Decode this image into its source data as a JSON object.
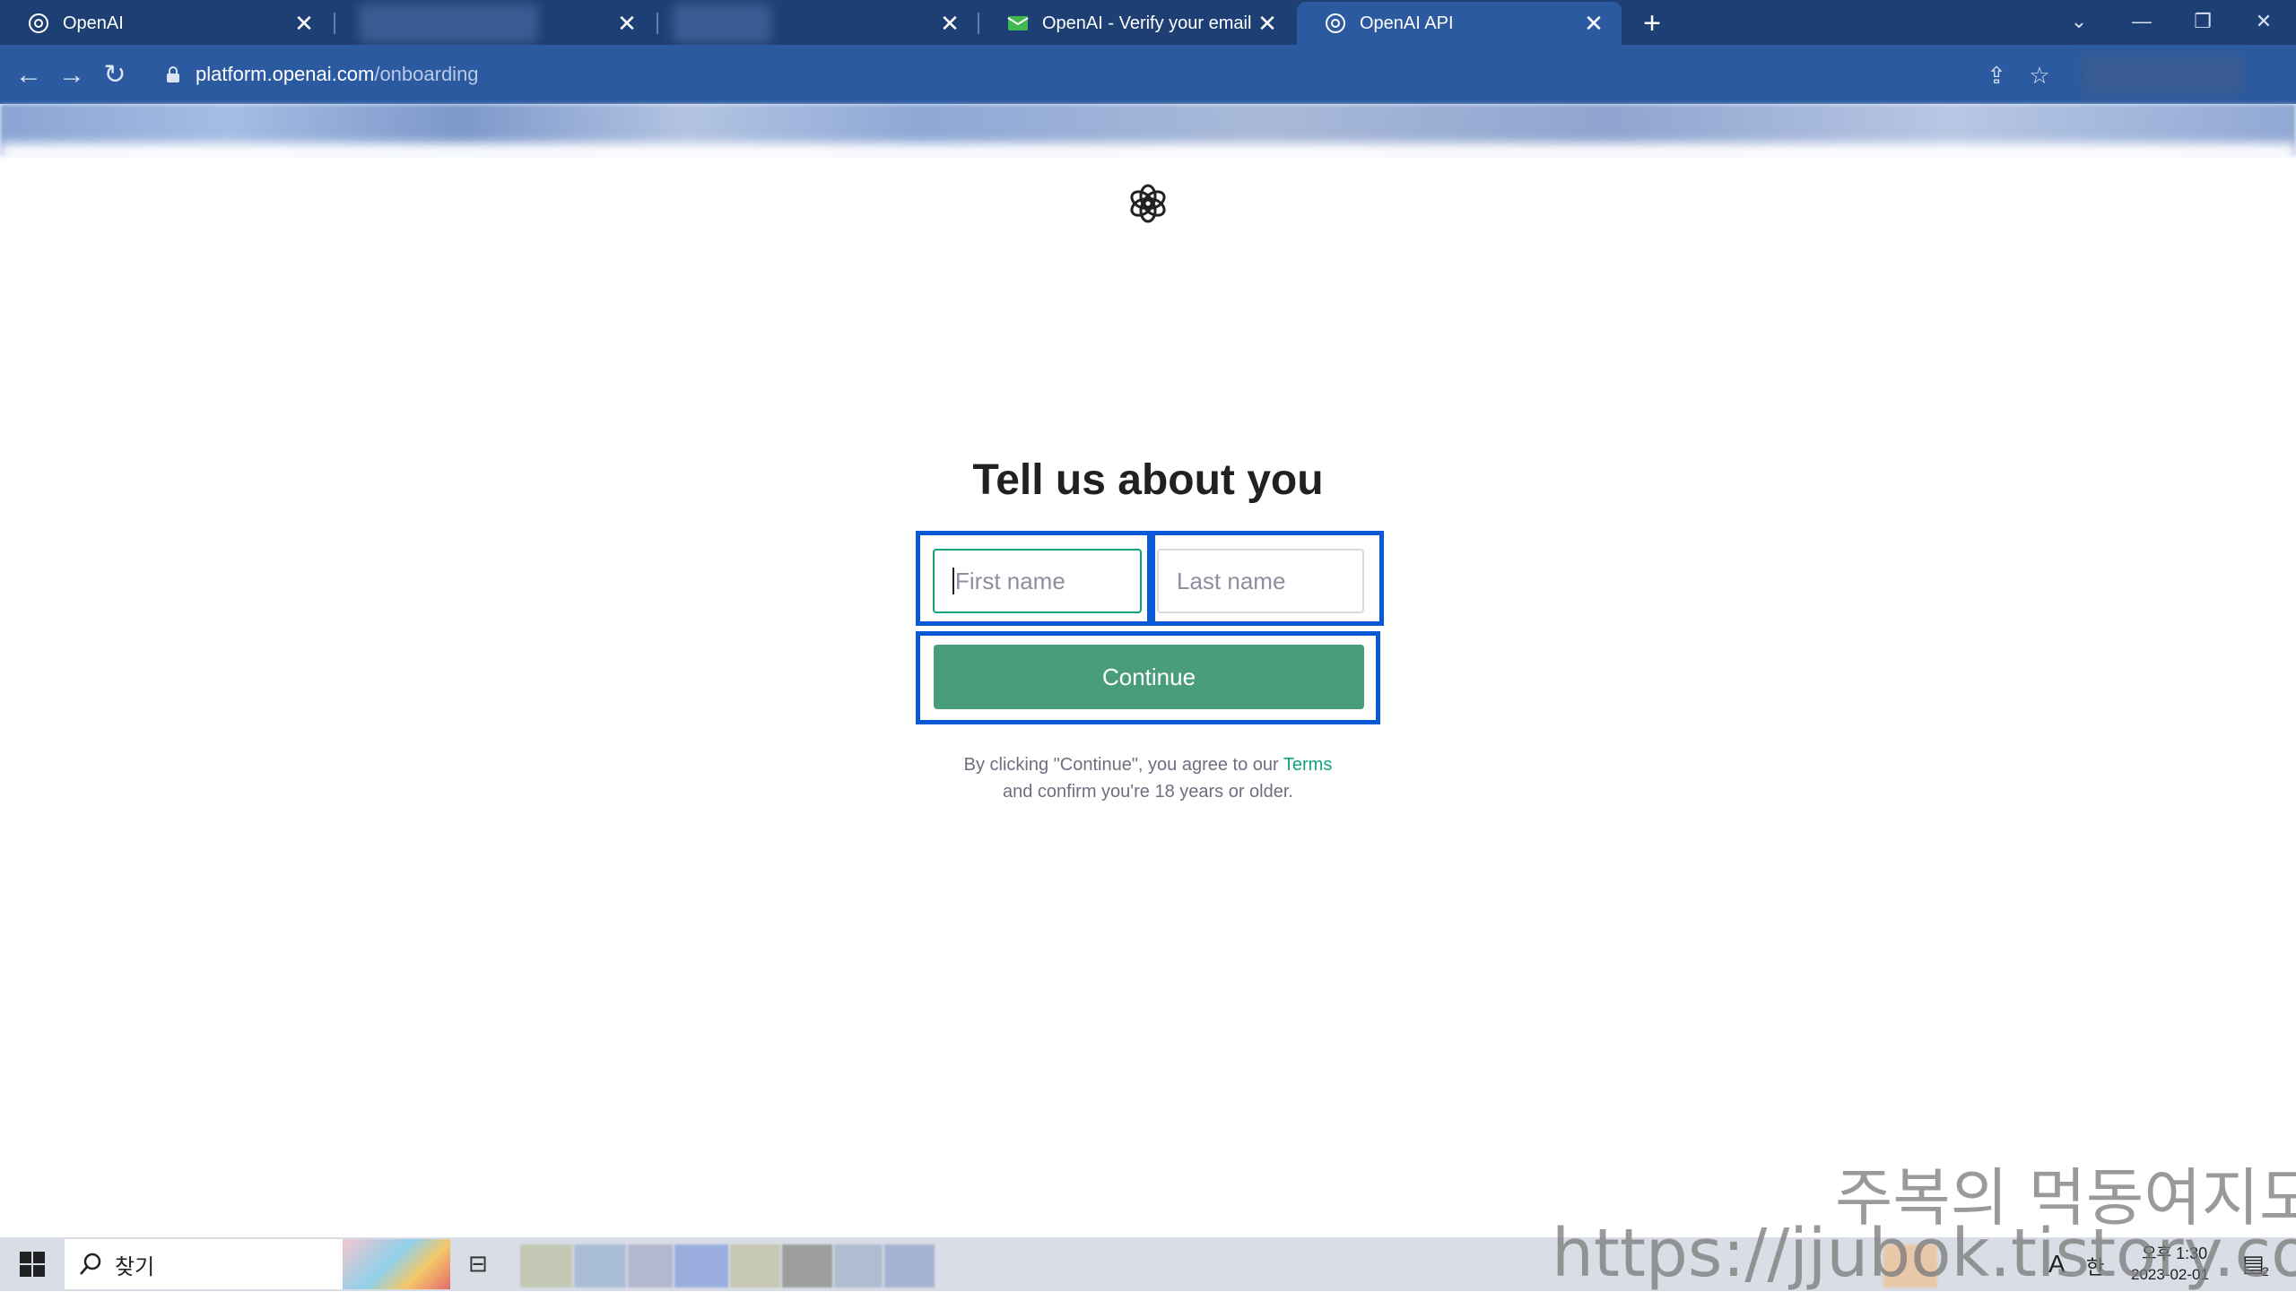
{
  "browser": {
    "tabs": [
      {
        "title": "OpenAI",
        "close": "✕"
      },
      {
        "title": "",
        "close": "✕"
      },
      {
        "title": "",
        "close": "✕"
      },
      {
        "title": "OpenAI - Verify your email",
        "close": "✕"
      },
      {
        "title": "OpenAI API",
        "close": "✕"
      }
    ],
    "new_tab": "+",
    "url_host": "platform.openai.com",
    "url_path": "/onboarding"
  },
  "page": {
    "title": "Tell us about you",
    "first_name_placeholder": "First name",
    "last_name_placeholder": "Last name",
    "continue_label": "Continue",
    "legal_line1_prefix": "By clicking \"Continue\", you agree to our ",
    "legal_terms": "Terms",
    "legal_line2": "and confirm you're 18 years or older."
  },
  "taskbar": {
    "search_text": "찾기",
    "taskview_glyph": "⊟",
    "ime_a": "A",
    "ime_han": "한",
    "time": "오후 1:30",
    "date": "2023-02-01",
    "notification_count": "2"
  },
  "watermark": {
    "line1": "주복의 먹동여지도",
    "line2": "https://jjubok.tistory.com"
  },
  "colors": {
    "tab_strip": "#1e3f73",
    "toolbar": "#2b5aa0",
    "accent_green": "#10a37f",
    "button_green": "#4a9d7c",
    "highlight_blue": "#0a5ad8"
  }
}
